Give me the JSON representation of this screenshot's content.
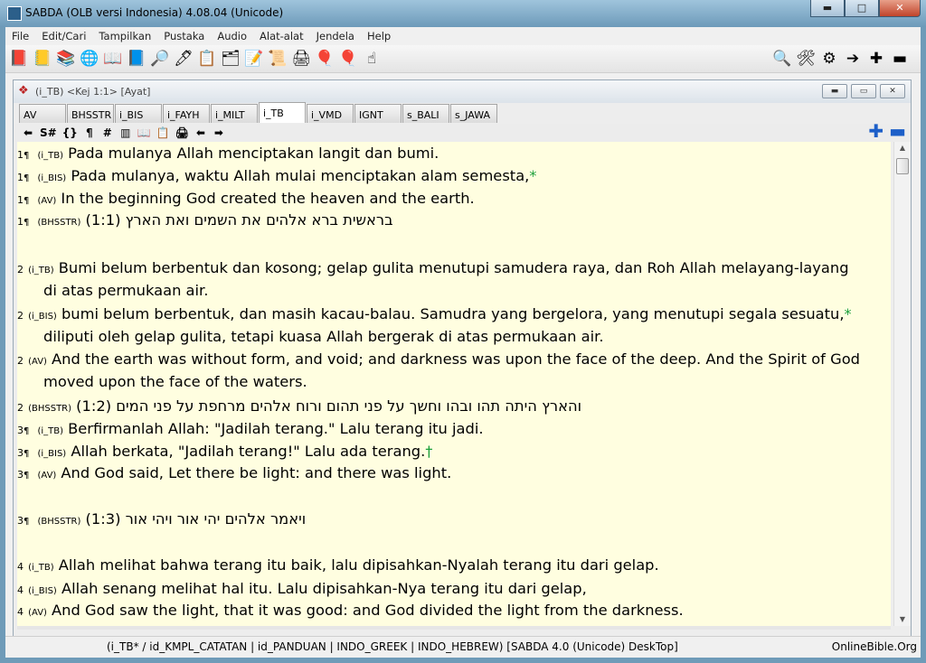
{
  "window": {
    "title": "SABDA (OLB versi Indonesia) 4.08.04  (Unicode)",
    "minimize": "▬",
    "maximize": "□",
    "close": "✕"
  },
  "menu": [
    "File",
    "Edit/Cari",
    "Tampilkan",
    "Pustaka",
    "Audio",
    "Alat-alat",
    "Jendela",
    "Help"
  ],
  "toolbar": {
    "left_icons": [
      {
        "name": "bible-icon",
        "glyph": "📕"
      },
      {
        "name": "books-yellow-icon",
        "glyph": "📒"
      },
      {
        "name": "books-stack-icon",
        "glyph": "📚"
      },
      {
        "name": "globe-icon",
        "glyph": "🌐"
      },
      {
        "name": "open-book-icon",
        "glyph": "📖"
      },
      {
        "name": "dictionary-icon",
        "glyph": "📘"
      },
      {
        "name": "search-books-icon",
        "glyph": "🔎"
      },
      {
        "name": "pen-icon",
        "glyph": "🖊"
      },
      {
        "name": "notepad-icon",
        "glyph": "📋"
      },
      {
        "name": "folder-icon",
        "glyph": "🗂"
      },
      {
        "name": "notes-icon",
        "glyph": "📝"
      },
      {
        "name": "scroll-icon",
        "glyph": "📜"
      },
      {
        "name": "printer-icon",
        "glyph": "🖨"
      },
      {
        "name": "balloon-icon",
        "glyph": "🎈"
      },
      {
        "name": "balloons-icon",
        "glyph": "🎈"
      },
      {
        "name": "pointer-hand-icon",
        "glyph": "☝"
      }
    ],
    "right_icons": [
      {
        "name": "magnifier-icon",
        "glyph": "🔍"
      },
      {
        "name": "tools-icon",
        "glyph": "🛠"
      },
      {
        "name": "gears-icon",
        "glyph": "⚙"
      },
      {
        "name": "arrow-right-icon",
        "glyph": "➔"
      },
      {
        "name": "zoom-in-icon",
        "glyph": "✚"
      },
      {
        "name": "zoom-out-icon",
        "glyph": "▬"
      }
    ]
  },
  "doc": {
    "title": "(i_TB) <Kej 1:1> [Ayat]",
    "min": "▬",
    "restore": "▭",
    "close": "✕"
  },
  "tabs": [
    {
      "label": "AV",
      "active": false
    },
    {
      "label": "BHSSTR",
      "active": false
    },
    {
      "label": "i_BIS",
      "active": false
    },
    {
      "label": "i_FAYH",
      "active": false
    },
    {
      "label": "i_MILT",
      "active": false
    },
    {
      "label": "i_TB",
      "active": true
    },
    {
      "label": "i_VMD",
      "active": false
    },
    {
      "label": "IGNT",
      "active": false
    },
    {
      "label": "s_BALI",
      "active": false
    },
    {
      "label": "s_JAWA",
      "active": false
    }
  ],
  "nav": {
    "back": "⬅",
    "strongs": "S#",
    "braces": "{}",
    "pilcrow": "¶",
    "hash": "#",
    "parallel": "▥",
    "book": "📖",
    "copy": "📋",
    "print": "🖨",
    "prev": "⬅",
    "next": "➡",
    "zoom_in": "✚",
    "zoom_out": "▬"
  },
  "verses": [
    {
      "id": "v1-tb",
      "num": "1",
      "pil": "¶",
      "tag": "(i_TB)",
      "text": "Pada mulanya Allah menciptakan langit dan bumi.",
      "note": ""
    },
    {
      "id": "v1-bis",
      "num": "1",
      "pil": "¶",
      "tag": "(i_BIS)",
      "text": "Pada mulanya, waktu Allah mulai menciptakan alam semesta,",
      "note": "*"
    },
    {
      "id": "v1-av",
      "num": "1",
      "pil": "¶",
      "tag": "(AV)",
      "text": "In the beginning God created the heaven and the earth.",
      "note": ""
    },
    {
      "id": "v1-heb",
      "num": "1",
      "pil": "¶",
      "tag": "(BHSSTR)",
      "text": "בראשית ברא אלהים את השמים ואת הארץ (1:1)",
      "note": ""
    },
    {
      "id": "v2-tb",
      "num": "2",
      "pil": "",
      "tag": "(i_TB)",
      "text": "Bumi belum berbentuk dan kosong; gelap gulita menutupi samudera raya, dan Roh Allah melayang-layang",
      "cont": "di atas permukaan air.",
      "note": ""
    },
    {
      "id": "v2-bis",
      "num": "2",
      "pil": "",
      "tag": "(i_BIS)",
      "text": "bumi belum berbentuk, dan masih kacau-balau. Samudra yang bergelora, yang menutupi segala sesuatu,",
      "cont": "diliputi oleh gelap gulita, tetapi kuasa Allah bergerak di atas permukaan air.",
      "note": "*"
    },
    {
      "id": "v2-av",
      "num": "2",
      "pil": "",
      "tag": "(AV)",
      "text": "And the earth was without form, and void; and darkness was  upon the face of the deep. And the Spirit of God",
      "cont": "moved upon the face of the waters.",
      "note": ""
    },
    {
      "id": "v2-heb",
      "num": "2",
      "pil": "",
      "tag": "(BHSSTR)",
      "text": "והארץ היתה תהו ובהו וחשך על פני תהום ורוח אלהים מרחפת על פני המים (1:2)",
      "note": ""
    },
    {
      "id": "v3-tb",
      "num": "3",
      "pil": "¶",
      "tag": "(i_TB)",
      "text": "Berfirmanlah Allah: \"Jadilah terang.\" Lalu terang itu jadi.",
      "note": ""
    },
    {
      "id": "v3-bis",
      "num": "3",
      "pil": "¶",
      "tag": "(i_BIS)",
      "text": "Allah berkata, \"Jadilah terang!\" Lalu ada terang.",
      "note": "†"
    },
    {
      "id": "v3-av",
      "num": "3",
      "pil": "¶",
      "tag": "(AV)",
      "text": "And God said, Let there be light: and there was light.",
      "note": ""
    },
    {
      "id": "v3-heb",
      "num": "3",
      "pil": "¶",
      "tag": "(BHSSTR)",
      "text": "ויאמר אלהים יהי אור ויהי אור (1:3)",
      "note": ""
    },
    {
      "id": "v4-tb",
      "num": "4",
      "pil": "",
      "tag": "(i_TB)",
      "text": "Allah melihat bahwa terang itu baik, lalu dipisahkan-Nyalah terang itu dari gelap.",
      "note": ""
    },
    {
      "id": "v4-bis",
      "num": "4",
      "pil": "",
      "tag": "(i_BIS)",
      "text": "Allah senang melihat hal itu. Lalu dipisahkan-Nya terang itu dari gelap,",
      "note": ""
    },
    {
      "id": "v4-av",
      "num": "4",
      "pil": "",
      "tag": "(AV)",
      "text": "And God saw the light, that it  was  good: and God divided the light from the darkness.",
      "note": ""
    }
  ],
  "status": {
    "modules": "(i_TB* / id_KMPL_CATATAN | id_PANDUAN | INDO_GREEK | INDO_HEBREW)     [SABDA 4.0 (Unicode) DeskTop]",
    "site": "OnlineBible.Org"
  },
  "scroll": {
    "up": "▲",
    "down": "▼"
  }
}
